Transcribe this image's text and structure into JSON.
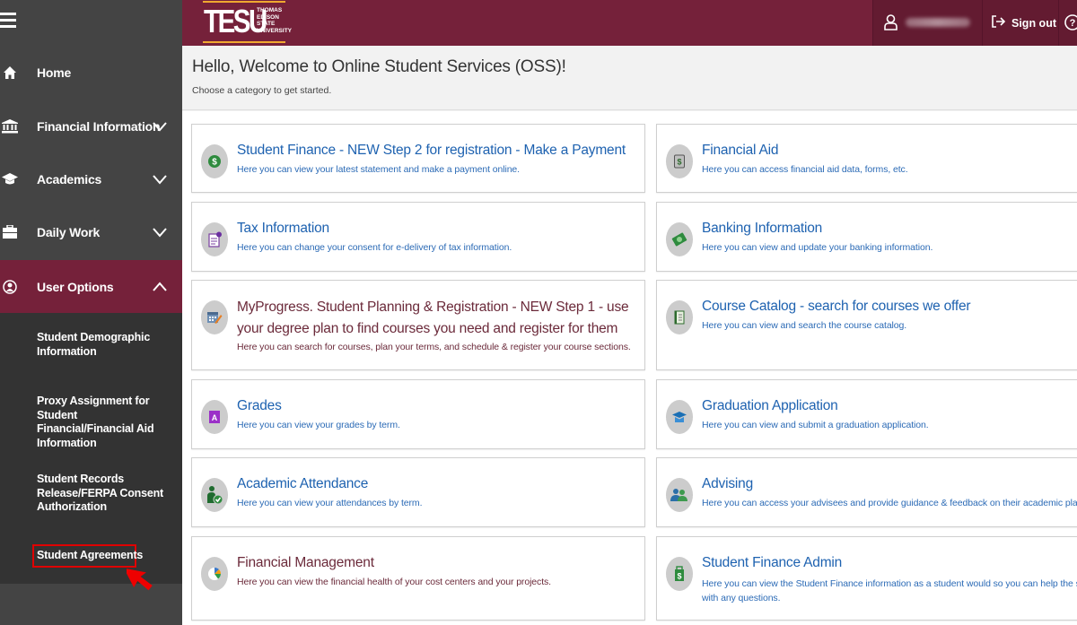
{
  "header": {
    "logo_main": "TESU",
    "logo_sub": [
      "THOMAS",
      "EDISON",
      "STATE",
      "UNIVERSITY"
    ],
    "user_icon": "user-icon",
    "signout_label": "Sign out",
    "help_icon": "help-icon",
    "colors": {
      "brand": "#75213a",
      "brand_dark": "#631b31",
      "logo_accent": "#f0a830"
    }
  },
  "sidebar": {
    "menu_icon": "hamburger-icon",
    "items": [
      {
        "label": "Home",
        "icon": "home-icon",
        "expandable": false
      },
      {
        "label": "Financial Information",
        "icon": "bank-icon",
        "expandable": true,
        "expanded": false
      },
      {
        "label": "Academics",
        "icon": "graduation-cap-icon",
        "expandable": true,
        "expanded": false
      },
      {
        "label": "Daily Work",
        "icon": "briefcase-icon",
        "expandable": true,
        "expanded": false
      },
      {
        "label": "User Options",
        "icon": "user-circle-icon",
        "expandable": true,
        "expanded": true
      }
    ],
    "submenu": [
      {
        "label": "Student Demographic Information"
      },
      {
        "label": "Proxy Assignment for Student Financial/Financial Aid Information"
      },
      {
        "label": "Student Records Release/FERPA Consent Authorization"
      },
      {
        "label": "Student Agreements",
        "highlighted": true
      }
    ],
    "colors": {
      "background": "#444444",
      "submenu_background": "#333333",
      "active": "#75213a",
      "highlight_box": "#e00000"
    }
  },
  "welcome": {
    "title": "Hello, Welcome to Online Student Services (OSS)!",
    "subtitle": "Choose a category to get started."
  },
  "cards": {
    "left": [
      {
        "title": "Student Finance - NEW Step 2 for registration - Make a Payment",
        "description": "Here you can view your latest statement and make a payment online.",
        "icon": "dollar-coin-icon"
      },
      {
        "title": "Tax Information",
        "description": "Here you can change your consent for e-delivery of tax information.",
        "icon": "tax-document-icon"
      },
      {
        "title": "MyProgress. Student Planning & Registration - NEW Step 1 - use your degree plan to find courses you need and register for them",
        "description": "Here you can search for courses, plan your terms, and schedule & register your course sections.",
        "icon": "calendar-edit-icon"
      },
      {
        "title": "Grades",
        "description": "Here you can view your grades by term.",
        "icon": "grade-a-icon"
      },
      {
        "title": "Academic Attendance",
        "description": "Here you can view your attendances by term.",
        "icon": "attendance-check-icon"
      },
      {
        "title": "Financial Management",
        "description": "Here you can view the financial health of your cost centers and your projects.",
        "icon": "pie-chart-icon"
      }
    ],
    "right": [
      {
        "title": "Financial Aid",
        "description": "Here you can access financial aid data, forms, etc.",
        "icon": "financial-aid-icon"
      },
      {
        "title": "Banking Information",
        "description": "Here you can view and update your banking information.",
        "icon": "money-bag-icon"
      },
      {
        "title": "Course Catalog - search for courses we offer",
        "description": "Here you can view and search the course catalog.",
        "icon": "catalog-book-icon"
      },
      {
        "title": "Graduation Application",
        "description": "Here you can view and submit a graduation application.",
        "icon": "graduation-icon"
      },
      {
        "title": "Advising",
        "description": "Here you can access your advisees and provide guidance & feedback on their academic planning.",
        "icon": "advisees-icon"
      },
      {
        "title": "Student Finance Admin",
        "description": "Here you can view the Student Finance information as a student would so you can help the student with any questions.",
        "icon": "finance-admin-icon"
      }
    ],
    "colors": {
      "link_blue": "#1e62b0",
      "maroon_text": "#6b2a3a",
      "icon_circle": "#cccccc"
    }
  }
}
